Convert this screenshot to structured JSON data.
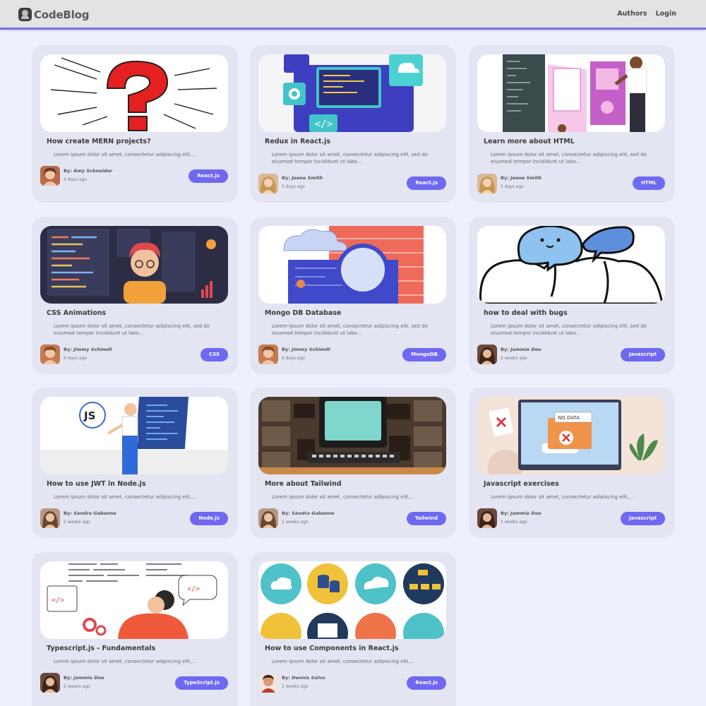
{
  "app": {
    "logo_text": "CodeBlog",
    "nav": {
      "authors": "Authors",
      "login": "Login"
    },
    "accent_color": "#6f68f0"
  },
  "posts": [
    {
      "title": "How create MERN projects?",
      "excerpt": "Lorem ipsum dolor sit amet, consectetur adipiscing elit,...",
      "byline_prefix": "By:",
      "author": "Amy Schneider",
      "time": "4 days ago",
      "tag": "React.js",
      "image": "question-mark-illustration"
    },
    {
      "title": "Redux in React.js",
      "excerpt": "Lorem ipsum dolor sit amet, consectetur adipiscing elit, sed do eiusmod tempor incididunt ut labo...",
      "byline_prefix": "By:",
      "author": "Jeane Smith",
      "time": "5 days ago",
      "tag": "React.js",
      "image": "code-screen-illustration"
    },
    {
      "title": "Learn more about HTML",
      "excerpt": "Lorem ipsum dolor sit amet, consectetur adipiscing elit, sed do eiusmod tempor incididunt ut labo...",
      "byline_prefix": "By:",
      "author": "Jeane Smith",
      "time": "5 days ago",
      "tag": "HTML",
      "image": "web-design-illustration"
    },
    {
      "title": "CSS Animations",
      "excerpt": "Lorem ipsum dolor sit amet, consectetur adipiscing elit, sed do eiusmod tempor incididunt ut labo...",
      "byline_prefix": "By:",
      "author": "Jimmy Schimdt",
      "time": "6 days ago",
      "tag": "CSS",
      "image": "developer-illustration"
    },
    {
      "title": "Mongo DB Database",
      "excerpt": "Lorem ipsum dolor sit amet, consectetur adipiscing elit, sed do eiusmod tempor incididunt ut labo...",
      "byline_prefix": "By:",
      "author": "Jimmy Schimdt",
      "time": "6 days ago",
      "tag": "MongoDB",
      "image": "database-search-illustration"
    },
    {
      "title": "how to deal with bugs",
      "excerpt": "Lorem ipsum dolor sit amet, consectetur adipiscing elit, sed do eiusmod tempor incididunt ut labo...",
      "byline_prefix": "By:",
      "author": "Jammie Doe",
      "time": "2 weeks ago",
      "tag": "Javascript",
      "image": "cat-illustration"
    },
    {
      "title": "How to use JWT in Node.js",
      "excerpt": "Lorem ipsum dolor sit amet, consectetur adipiscing elit,...",
      "byline_prefix": "By:",
      "author": "Sandra Gabanne",
      "time": "2 weeks ago",
      "tag": "Node.js",
      "image": "js-presenter-illustration"
    },
    {
      "title": "More about Tailwind",
      "excerpt": "Lorem ipsum dolor sit amet, consectetur adipiscing elit,...",
      "byline_prefix": "By:",
      "author": "Sandra Gabanne",
      "time": "2 weeks ago",
      "tag": "Tailwind",
      "image": "retro-computer-image"
    },
    {
      "title": "Javascript exercises",
      "excerpt": "Lorem ipsum dolor sit amet, consectetur adipiscing elit,...",
      "byline_prefix": "By:",
      "author": "Jammie Doe",
      "time": "2 weeks ago",
      "tag": "Javascript",
      "image": "no-data-illustration",
      "image_text": "NO DATA"
    },
    {
      "title": "Typescript.js - Fundamentals",
      "excerpt": "Lorem ipsum dolor sit amet, consectetur adipiscing elit,...",
      "byline_prefix": "By:",
      "author": "Jammie Doe",
      "time": "2 weeks ago",
      "tag": "TypeScript.js",
      "image": "coder-hoodie-illustration"
    },
    {
      "title": "How to use Components in React.js",
      "excerpt": "Lorem ipsum dolor sit amet, consectetur adipiscing elit,...",
      "byline_prefix": "By:",
      "author": "Dennis Salvo",
      "time": "2 weeks ago",
      "tag": "React.js",
      "image": "components-icons-illustration"
    }
  ]
}
